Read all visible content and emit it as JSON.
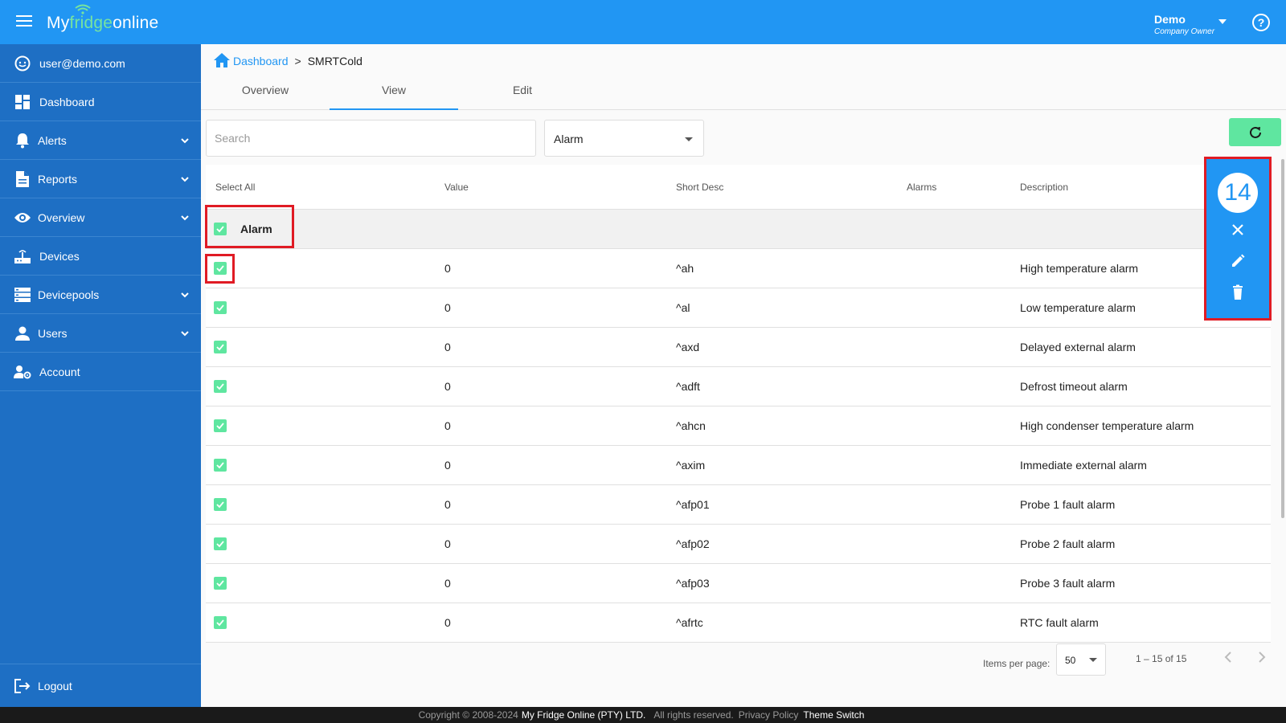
{
  "app": {
    "logo_left": "My",
    "logo_mid": "fridge",
    "logo_right": "online",
    "user_name": "Demo",
    "user_role": "Company Owner"
  },
  "sidebar": {
    "account_email": "user@demo.com",
    "items": [
      {
        "label": "Dashboard",
        "icon": "dashboard-icon"
      },
      {
        "label": "Alerts",
        "icon": "bell-icon"
      },
      {
        "label": "Reports",
        "icon": "document-icon"
      },
      {
        "label": "Overview",
        "icon": "eye-icon"
      },
      {
        "label": "Devices",
        "icon": "router-icon"
      },
      {
        "label": "Devicepools",
        "icon": "storage-icon"
      },
      {
        "label": "Users",
        "icon": "person-icon"
      },
      {
        "label": "Account",
        "icon": "person-gear-icon"
      }
    ],
    "logout_label": "Logout"
  },
  "breadcrumb": {
    "home": "Dashboard",
    "separator": ">",
    "current": "SMRTCold"
  },
  "tabs": [
    "Overview",
    "View",
    "Edit"
  ],
  "active_tab": "View",
  "filter": {
    "search_placeholder": "Search",
    "select_value": "Alarm"
  },
  "table": {
    "headers": {
      "select_all": "Select All",
      "value": "Value",
      "short_desc": "Short Desc",
      "alarms": "Alarms",
      "description": "Description"
    },
    "group_label": "Alarm",
    "rows": [
      {
        "value": "0",
        "short_desc": "^ah",
        "alarms": "",
        "description": "High temperature alarm"
      },
      {
        "value": "0",
        "short_desc": "^al",
        "alarms": "",
        "description": "Low temperature alarm"
      },
      {
        "value": "0",
        "short_desc": "^axd",
        "alarms": "",
        "description": "Delayed external alarm"
      },
      {
        "value": "0",
        "short_desc": "^adft",
        "alarms": "",
        "description": "Defrost timeout alarm"
      },
      {
        "value": "0",
        "short_desc": "^ahcn",
        "alarms": "",
        "description": "High condenser temperature alarm"
      },
      {
        "value": "0",
        "short_desc": "^axim",
        "alarms": "",
        "description": "Immediate external alarm"
      },
      {
        "value": "0",
        "short_desc": "^afp01",
        "alarms": "",
        "description": "Probe 1 fault alarm"
      },
      {
        "value": "0",
        "short_desc": "^afp02",
        "alarms": "",
        "description": "Probe 2 fault alarm"
      },
      {
        "value": "0",
        "short_desc": "^afp03",
        "alarms": "",
        "description": "Probe 3 fault alarm"
      },
      {
        "value": "0",
        "short_desc": "^afrtc",
        "alarms": "",
        "description": "RTC fault alarm"
      }
    ]
  },
  "selection": {
    "count": "14"
  },
  "pagination": {
    "items_per_page_label": "Items per page:",
    "items_per_page": "50",
    "range": "1 – 15 of 15"
  },
  "footer": {
    "copyright": "Copyright © 2008-2024",
    "company": "My Fridge Online (PTY) LTD.",
    "rights": "All rights reserved.",
    "privacy": "Privacy Policy",
    "theme": "Theme Switch"
  },
  "colors": {
    "primary": "#2196f3",
    "sidebar": "#1e6fc4",
    "accent_green": "#5fe6a0",
    "highlight_red": "#e01b24"
  }
}
